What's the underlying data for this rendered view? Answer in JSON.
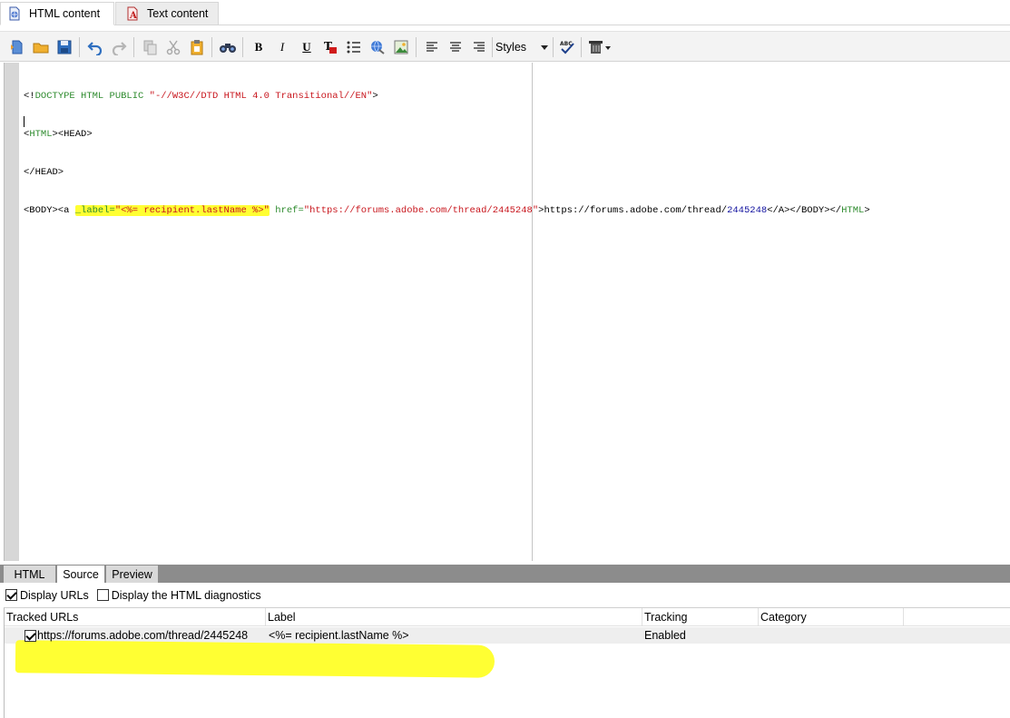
{
  "tabs": [
    {
      "label": "HTML content",
      "icon": "html-content-icon",
      "active": true
    },
    {
      "label": "Text content",
      "icon": "text-content-icon",
      "active": false
    }
  ],
  "toolbar": {
    "bold_label": "B",
    "italic_label": "I",
    "underline_label": "U",
    "styles_label": "Styles"
  },
  "code": {
    "line1": {
      "p1": "<!",
      "p2": "DOCTYPE HTML PUBLIC",
      "p3": " ",
      "p4": "\"-//W3C//DTD HTML 4.0 Transitional//EN\"",
      "p5": ">"
    },
    "line2": {
      "p1": "<",
      "p2": "HTML",
      "p3": "><HEAD>"
    },
    "line3": {
      "p1": "</HEAD>"
    },
    "line4": {
      "p1": "<BODY><a ",
      "p2": "_label=",
      "p3": "\"<%= recipient.lastName %>\"",
      "p4": " ",
      "p5": "href=",
      "p6": "\"https://forums.adobe.com/thread/2445248\"",
      "p7": ">https://forums.adobe.com/thread/",
      "p8": "2445248",
      "p9": "</A></BODY></",
      "p10": "HTML",
      "p11": ">"
    }
  },
  "bottom_tabs": [
    {
      "label": "HTML",
      "active": false
    },
    {
      "label": "Source",
      "active": true
    },
    {
      "label": "Preview",
      "active": false
    }
  ],
  "options": {
    "display_urls": {
      "label": "Display URLs",
      "checked": true
    },
    "display_diagnostics": {
      "label": "Display the HTML diagnostics",
      "checked": false
    }
  },
  "table": {
    "headers": [
      "Tracked URLs",
      "Label",
      "Tracking",
      "Category"
    ],
    "rows": [
      {
        "checked": true,
        "url": "https://forums.adobe.com/thread/2445248",
        "label": "<%= recipient.lastName %>",
        "tracking": "Enabled",
        "category": ""
      }
    ]
  },
  "colors": {
    "highlight": "#ffff33",
    "code_keyword": "#2e8b2e",
    "code_string": "#c8161d",
    "code_number": "#1414a0",
    "bottom_bar": "#8c8c8c"
  }
}
